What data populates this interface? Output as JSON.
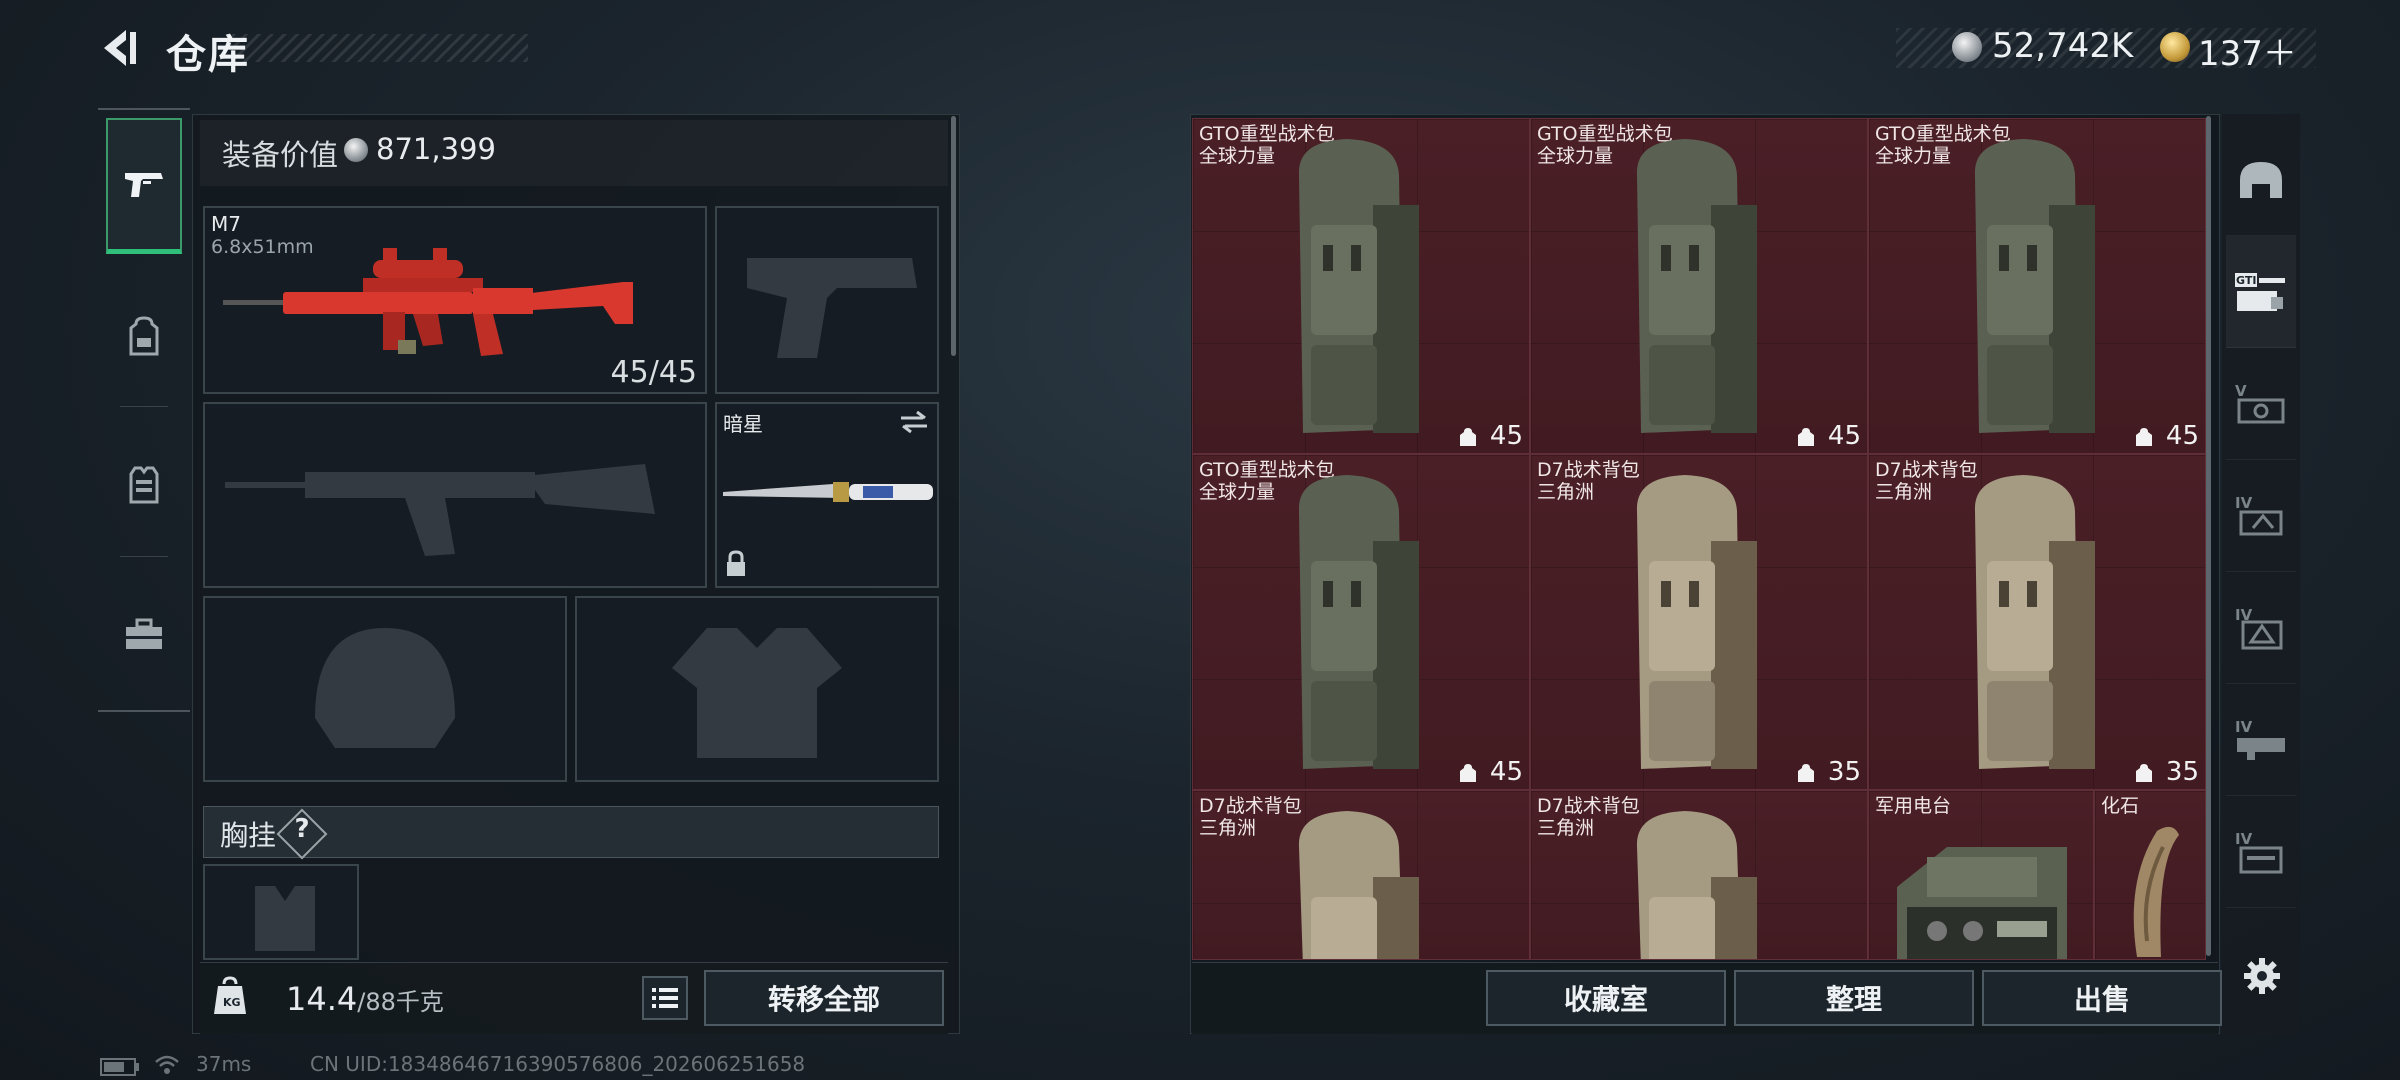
{
  "header": {
    "title": "仓库"
  },
  "currency": [
    {
      "value": "52,742K",
      "icon": "silver-coin-icon"
    },
    {
      "value": "137＋",
      "icon": "gold-coin-icon"
    }
  ],
  "left_tabs": [
    {
      "name": "weapons",
      "icon": "pistol-icon",
      "active": true
    },
    {
      "name": "backpack",
      "icon": "backpack-icon",
      "active": false
    },
    {
      "name": "vest",
      "icon": "vest-icon",
      "active": false
    },
    {
      "name": "toolbox",
      "icon": "toolbox-icon",
      "active": false
    }
  ],
  "equipment": {
    "value_label": "装备价值",
    "value": "871,399",
    "primary": {
      "name": "M7",
      "caliber": "6.8x51mm",
      "ammo": "45/45",
      "color": "#d9382e"
    },
    "melee": {
      "name": "暗星",
      "locked": true
    },
    "chest_section": {
      "label": "胸挂",
      "help": "?"
    },
    "weight": {
      "current": "14.4",
      "max": "/88千克"
    },
    "transfer_all_label": "转移全部"
  },
  "inventory": {
    "items": [
      {
        "name": "GTO重型战术包",
        "sub": "全球力量",
        "capacity": "45",
        "tone": "green"
      },
      {
        "name": "GTO重型战术包",
        "sub": "全球力量",
        "capacity": "45",
        "tone": "green"
      },
      {
        "name": "GTO重型战术包",
        "sub": "全球力量",
        "capacity": "45",
        "tone": "green"
      },
      {
        "name": "GTO重型战术包",
        "sub": "全球力量",
        "capacity": "45",
        "tone": "green"
      },
      {
        "name": "D7战术背包",
        "sub": "三角洲",
        "capacity": "35",
        "tone": "tan"
      },
      {
        "name": "D7战术背包",
        "sub": "三角洲",
        "capacity": "35",
        "tone": "tan"
      },
      {
        "name": "D7战术背包",
        "sub": "三角洲",
        "capacity": "",
        "tone": "tan"
      },
      {
        "name": "D7战术背包",
        "sub": "三角洲",
        "capacity": "",
        "tone": "tan"
      },
      {
        "name": "军用电台",
        "sub": "",
        "capacity": "",
        "tone": "radio"
      },
      {
        "name": "化石",
        "sub": "",
        "capacity": "",
        "tone": "fossil"
      }
    ],
    "buttons": {
      "collection": "收藏室",
      "sort": "整理",
      "sell": "出售"
    }
  },
  "filters": [
    {
      "icon": "helmet-filter-icon",
      "label": ""
    },
    {
      "icon": "gti-filter-icon",
      "label": "GTI"
    },
    {
      "icon": "tier5-filter-icon",
      "label": "V"
    },
    {
      "icon": "tier4-filter-icon",
      "label": "IV"
    },
    {
      "icon": "tier4-armor-filter-icon",
      "label": "IV"
    },
    {
      "icon": "tier4-rig-filter-icon",
      "label": "IV"
    },
    {
      "icon": "tier4-bag-filter-icon",
      "label": "IV"
    }
  ],
  "status": {
    "ping": "37ms",
    "uid": "CN UID:18348646716390576806_202606251658"
  },
  "colors": {
    "accent_green": "#2fbf7a",
    "cell_red": "#4a1f26",
    "panel": "#12181d"
  }
}
